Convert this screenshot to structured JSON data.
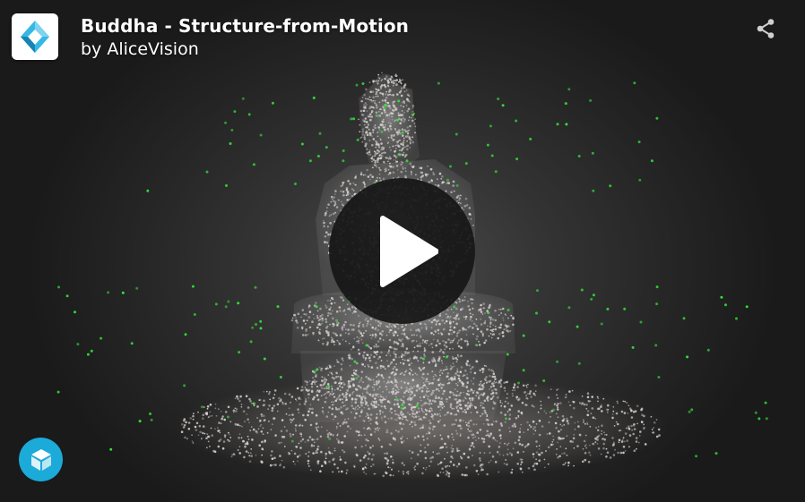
{
  "model": {
    "title": "Buddha - Structure-from-Motion",
    "author_prefix": "by",
    "author": "AliceVision",
    "author_line": "by AliceVision"
  },
  "icons": {
    "thumbnail": "alicevision-logo-icon",
    "share": "share-icon",
    "play": "play-icon",
    "brand": "sketchfab-logo-icon"
  },
  "colors": {
    "background": "#2b2b2b",
    "point_cloud": "#c8c1bd",
    "camera_points": "#35e03a",
    "play_button": "#161616",
    "brand_badge": "#1caad9"
  }
}
